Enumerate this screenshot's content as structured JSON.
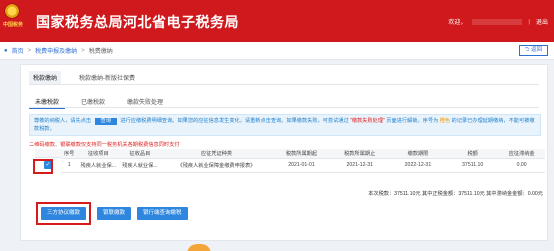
{
  "header": {
    "emblem_text": "中国税务",
    "site_title": "国家税务总局河北省电子税务局",
    "welcome": "欢迎，",
    "separator": "|",
    "logout": "退出"
  },
  "breadcrumb": {
    "home": "首页",
    "sep1": ">",
    "level1": "税费申报及缴纳",
    "sep2": ">",
    "current": "税费缴纳",
    "back": "返回"
  },
  "top_tabs": [
    {
      "label": "税款缴纳",
      "active": true
    },
    {
      "label": "税款缴纳-新版社保费",
      "active": false
    }
  ],
  "sub_tabs": [
    {
      "label": "未缴税款",
      "active": true
    },
    {
      "label": "已缴税款",
      "active": false
    },
    {
      "label": "缴款失败处理",
      "active": false
    }
  ],
  "notice": {
    "part1": "尊敬的纳税人，请先点击",
    "query_btn": "查询",
    "part2": "进行应缴税费明细查询。如果您的应征信息发生变化，请重新点击查询。如果缴款失败，可尝试通过",
    "link1": "\"缴款失败处理\"",
    "part3": "页面进行解锁。序号为",
    "orange": "橙色",
    "part4": "的记录已办理延期缴纳，不能可被缴款税款。"
  },
  "warn": "二维码缴款、银联缴款仅支持同一税务机关各期税费信息同时支付",
  "table": {
    "headers": [
      "序号",
      "征收项目",
      "征收品目",
      "应征凭证种类",
      "税款所属期起",
      "税款所属期止",
      "缴款期限",
      "税额",
      "应征滞纳金"
    ],
    "rows": [
      [
        "1",
        "残疾人就业保...",
        "残疾人就业保...",
        "《残疾人就业保障金缴费申报表》",
        "2021-01-01",
        "2021-12-31",
        "2022-12-31",
        "37511.10",
        "0.00"
      ]
    ]
  },
  "summary": "本次税款：37511.10元  其中正税金额：37511.10元  其中滞纳金金额：0.00元",
  "actions": {
    "tripartite": "三方协议缴款",
    "unionpay": "银联缴款",
    "bank_terminal": "银行端查询缴税"
  }
}
